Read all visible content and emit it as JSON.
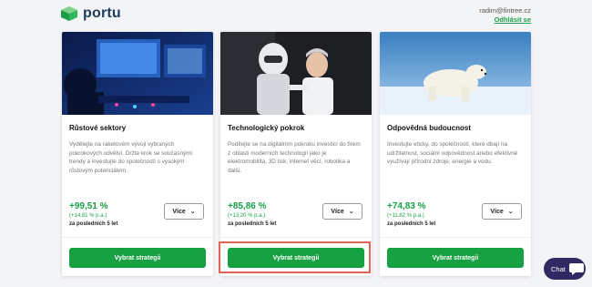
{
  "header": {
    "brand": "portu",
    "email": "radim@fintree.cz",
    "logout_label": "Odhlásit se"
  },
  "cards": [
    {
      "title": "Růstové sektory",
      "description": "Vydělejte na raketovém vývoji vybraných pokrokových odvětví. Držte krok se současnými trendy a investujte do společností s vysokým růstovým potenciálem.",
      "performance": "+99,51 %",
      "per_annum": "(+14,81 % p.a.)",
      "period": "za posledních 5 let",
      "more_label": "Více",
      "select_label": "Vybrat strategii"
    },
    {
      "title": "Technologický pokrok",
      "description": "Podílejte se na digitálním pokroku investicí do firem z oblasti moderních technologií jako je elektromobilita, 3D tisk, internet věcí, robotika a další.",
      "performance": "+85,86 %",
      "per_annum": "(+13,20 % p.a.)",
      "period": "za posledních 5 let",
      "more_label": "Více",
      "select_label": "Vybrat strategii"
    },
    {
      "title": "Odpovědná budoucnost",
      "description": "Investujte eticky, do společností, které dbají na udržitelnost, sociální odpovědnost anebo efektivně využívají přírodní zdroje, energie a vodu.",
      "performance": "+74,83 %",
      "per_annum": "(+11,82 % p.a.)",
      "period": "za posledních 5 let",
      "more_label": "Více",
      "select_label": "Vybrat strategii"
    }
  ],
  "chat": {
    "label": "Chat"
  },
  "colors": {
    "accent_green": "#18a143",
    "highlight_red": "#e46355",
    "chat_purple": "#2f2a63"
  }
}
